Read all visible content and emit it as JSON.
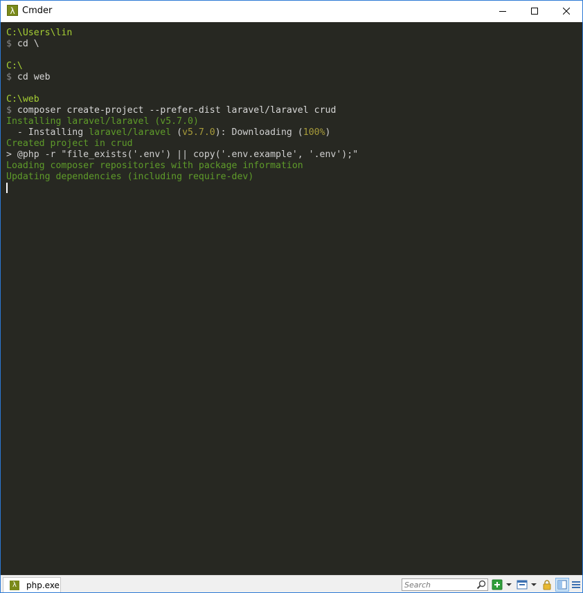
{
  "window": {
    "title": "Cmder",
    "icon_glyph": "λ"
  },
  "terminal": {
    "lines": [
      [
        {
          "t": "C:\\Users\\lin",
          "c": "path"
        }
      ],
      [
        {
          "t": "$ ",
          "c": "prompt"
        },
        {
          "t": "cd \\",
          "c": "cmd"
        }
      ],
      [],
      [
        {
          "t": "C:\\",
          "c": "path"
        }
      ],
      [
        {
          "t": "$ ",
          "c": "prompt"
        },
        {
          "t": "cd web",
          "c": "cmd"
        }
      ],
      [],
      [
        {
          "t": "C:\\web",
          "c": "path"
        }
      ],
      [
        {
          "t": "$ ",
          "c": "prompt"
        },
        {
          "t": "composer create-project --prefer-dist laravel/laravel crud",
          "c": "cmd"
        }
      ],
      [
        {
          "t": "Installing laravel/laravel (v5.7.0)",
          "c": "green"
        }
      ],
      [
        {
          "t": "  - Installing ",
          "c": "default"
        },
        {
          "t": "laravel/laravel",
          "c": "green"
        },
        {
          "t": " (",
          "c": "default"
        },
        {
          "t": "v5.7.0",
          "c": "yellow"
        },
        {
          "t": "): Downloading (",
          "c": "default"
        },
        {
          "t": "100%",
          "c": "yellow"
        },
        {
          "t": ")",
          "c": "default"
        }
      ],
      [
        {
          "t": "Created project in crud",
          "c": "green"
        }
      ],
      [
        {
          "t": "> @php -r \"file_exists('.env') || copy('.env.example', '.env');\"",
          "c": "default"
        }
      ],
      [
        {
          "t": "Loading composer repositories with package information",
          "c": "green"
        }
      ],
      [
        {
          "t": "Updating dependencies (including require-dev)",
          "c": "green"
        }
      ]
    ]
  },
  "statusbar": {
    "tab_label": "php.exe",
    "search_placeholder": "Search"
  },
  "colors": {
    "path": "#a6cf34",
    "prompt": "#888888",
    "cmd": "#d8d8d8",
    "green": "#5f9c2a",
    "yellow": "#a89c3a",
    "default": "#d0d0d0",
    "terminal_bg": "#272822",
    "accent": "#7a8a1a"
  },
  "icons": {
    "minimize": "minimize-icon",
    "maximize": "maximize-icon",
    "close": "close-icon",
    "search": "search-icon",
    "new_console": "plus-icon",
    "lock": "lock-icon",
    "menu": "hamburger-menu-icon"
  }
}
